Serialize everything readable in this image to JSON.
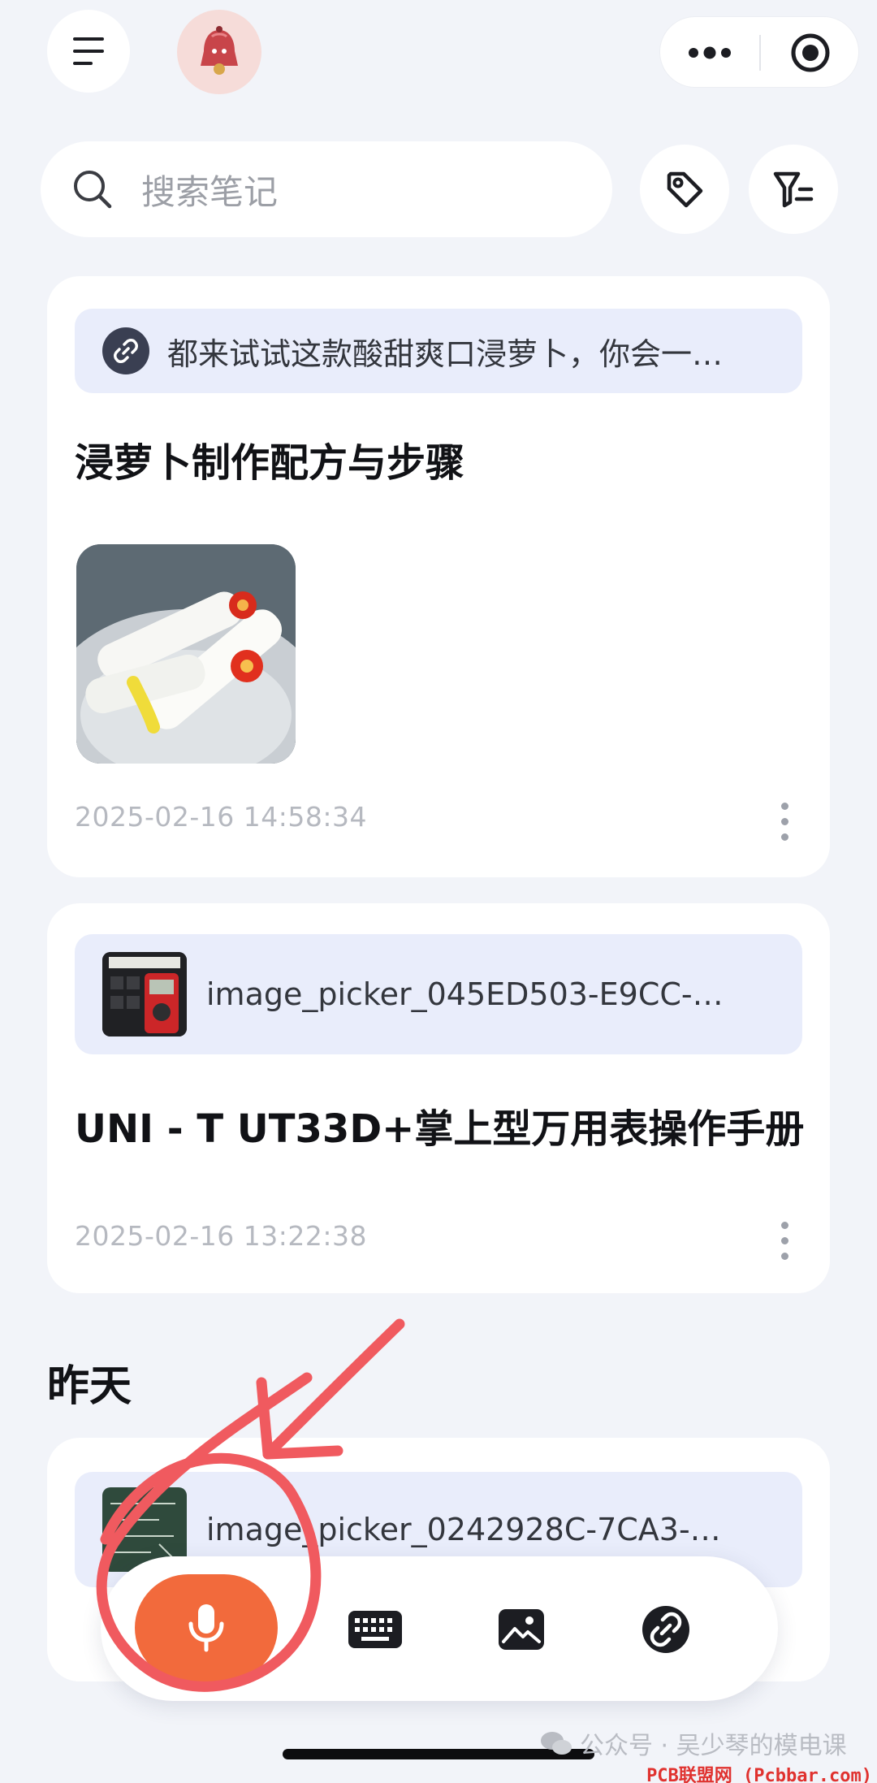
{
  "header": {
    "menu_icon": "hamburger-menu-icon",
    "avatar_icon": "bell-mascot-icon",
    "more_icon": "more-dots-icon",
    "target_icon": "record-target-icon"
  },
  "search": {
    "placeholder": "搜索笔记",
    "tag_icon": "tag-icon",
    "filter_icon": "filter-icon"
  },
  "notes": [
    {
      "source_text": "都来试试这款酸甜爽口浸萝卜，你会一…",
      "source_icon": "link-icon",
      "title": "浸萝卜制作配方与步骤",
      "timestamp": "2025-02-16 14:58:34"
    },
    {
      "source_text": "image_picker_045ED503-E9CC-…",
      "title": "UNI - T UT33D+掌上型万用表操作手册",
      "timestamp": "2025-02-16 13:22:38"
    }
  ],
  "section_yesterday": "昨天",
  "notes_yesterday": [
    {
      "source_text": "image_picker_0242928C-7CA3-…"
    }
  ],
  "toolbar": {
    "mic_icon": "microphone-icon",
    "keyboard_icon": "keyboard-icon",
    "image_icon": "image-icon",
    "link_icon": "link-icon"
  },
  "watermark": {
    "account": "公众号 · 吴少琴的模电课",
    "site": "PCB联盟网 (Pcbbar.com)"
  },
  "colors": {
    "background": "#f2f4f9",
    "accent_orange": "#f26a3c",
    "annotation_red": "#f05a5f",
    "source_bg": "#e9edfb"
  }
}
